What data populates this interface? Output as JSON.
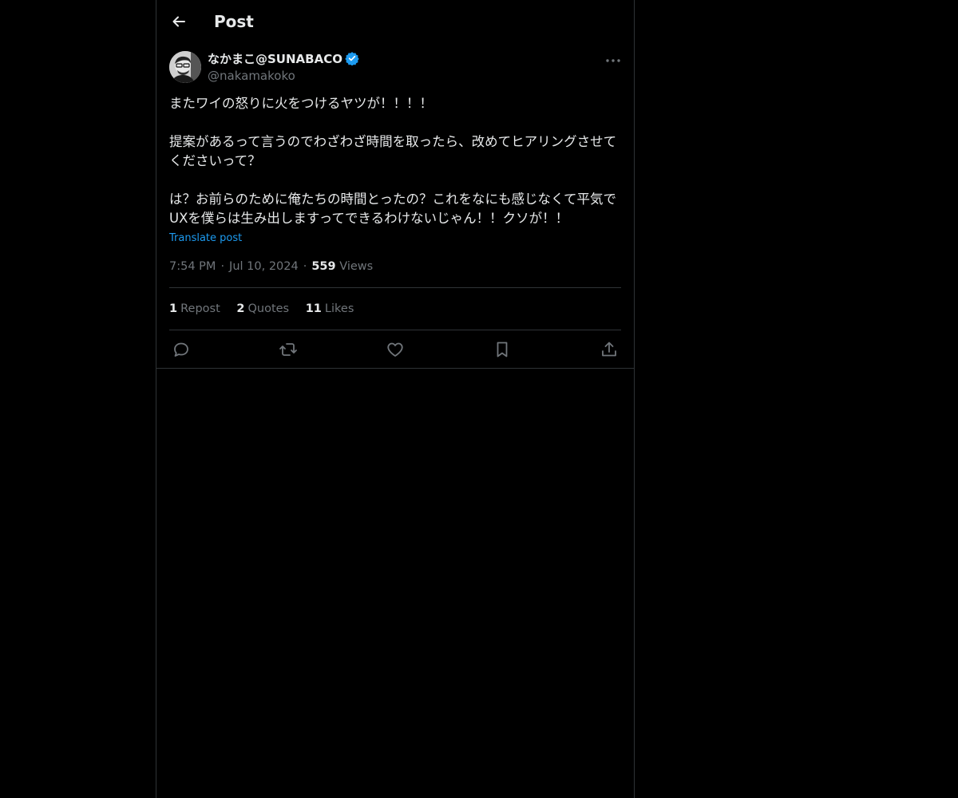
{
  "header": {
    "back_icon": "arrow-left-icon",
    "title": "Post"
  },
  "post": {
    "author": {
      "display_name": "なかまこ@SUNABACO",
      "handle": "@nakamakoko",
      "verified": true,
      "verified_color": "#1d9bf0"
    },
    "more_icon": "more-horizontal-icon",
    "paragraphs": [
      "またワイの怒りに火をつけるヤツが！！！！",
      "提案があるって言うのでわざわざ時間を取ったら、改めてヒアリングさせてくださいって？",
      "は？お前らのために俺たちの時間とったの？これをなにも感じなくて平気でUXを僕らは生み出しますってできるわけないじゃん！！クソが！！"
    ],
    "translate_label": "Translate post",
    "time": "7:54 PM",
    "date": "Jul 10, 2024",
    "dot": "·",
    "views_count": "559",
    "views_label": "Views",
    "stats": [
      {
        "count": "1",
        "label": "Repost"
      },
      {
        "count": "2",
        "label": "Quotes"
      },
      {
        "count": "11",
        "label": "Likes"
      }
    ],
    "actions": [
      "reply-icon",
      "repost-icon",
      "like-icon",
      "bookmark-icon",
      "share-icon"
    ]
  },
  "colors": {
    "background": "#000000",
    "text": "#e7e9ea",
    "muted": "#71767b",
    "border": "#2f3336",
    "link": "#1d9bf0"
  }
}
